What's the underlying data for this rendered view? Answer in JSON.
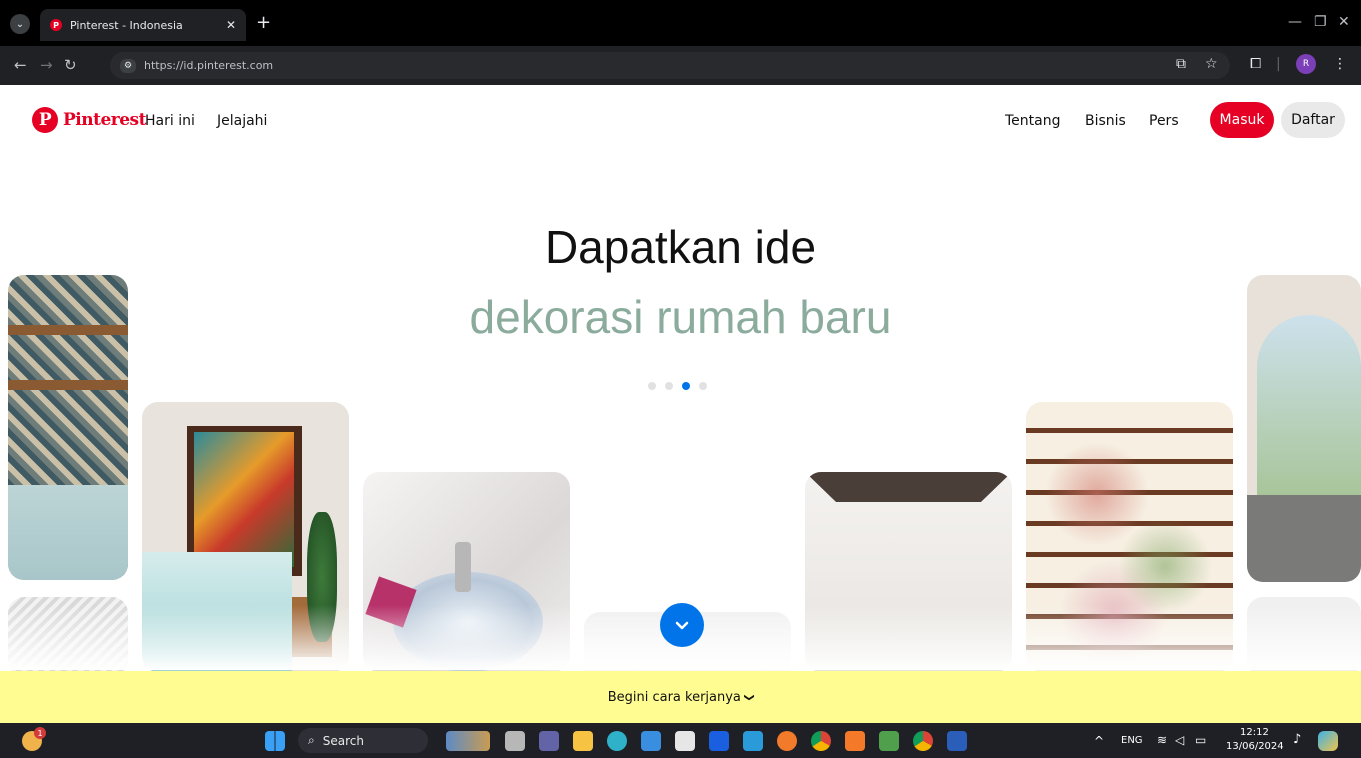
{
  "browser": {
    "tab_title": "Pinterest - Indonesia",
    "url": "https://id.pinterest.com",
    "profile_initial": "R",
    "new_tab_symbol": "+"
  },
  "header": {
    "logo_text": "Pinterest",
    "nav_left": [
      "Hari ini",
      "Jelajahi"
    ],
    "nav_right": [
      "Tentang",
      "Bisnis",
      "Pers"
    ],
    "login_label": "Masuk",
    "signup_label": "Daftar"
  },
  "hero": {
    "line1": "Dapatkan ide",
    "line2": "dekorasi rumah baru",
    "accent_color": "#8bab9c",
    "carousel_total": 4,
    "carousel_active": 3
  },
  "footer_bar": {
    "label": "Begini cara kerjanya",
    "chevron": "❯"
  },
  "taskbar": {
    "search_label": "Search",
    "lang": "ENG",
    "time": "12:12",
    "date": "13/06/2024",
    "widget_badge": "1"
  },
  "colors": {
    "brand": "#e60023",
    "link_blue": "#0074e8",
    "banner": "#fffd92"
  }
}
